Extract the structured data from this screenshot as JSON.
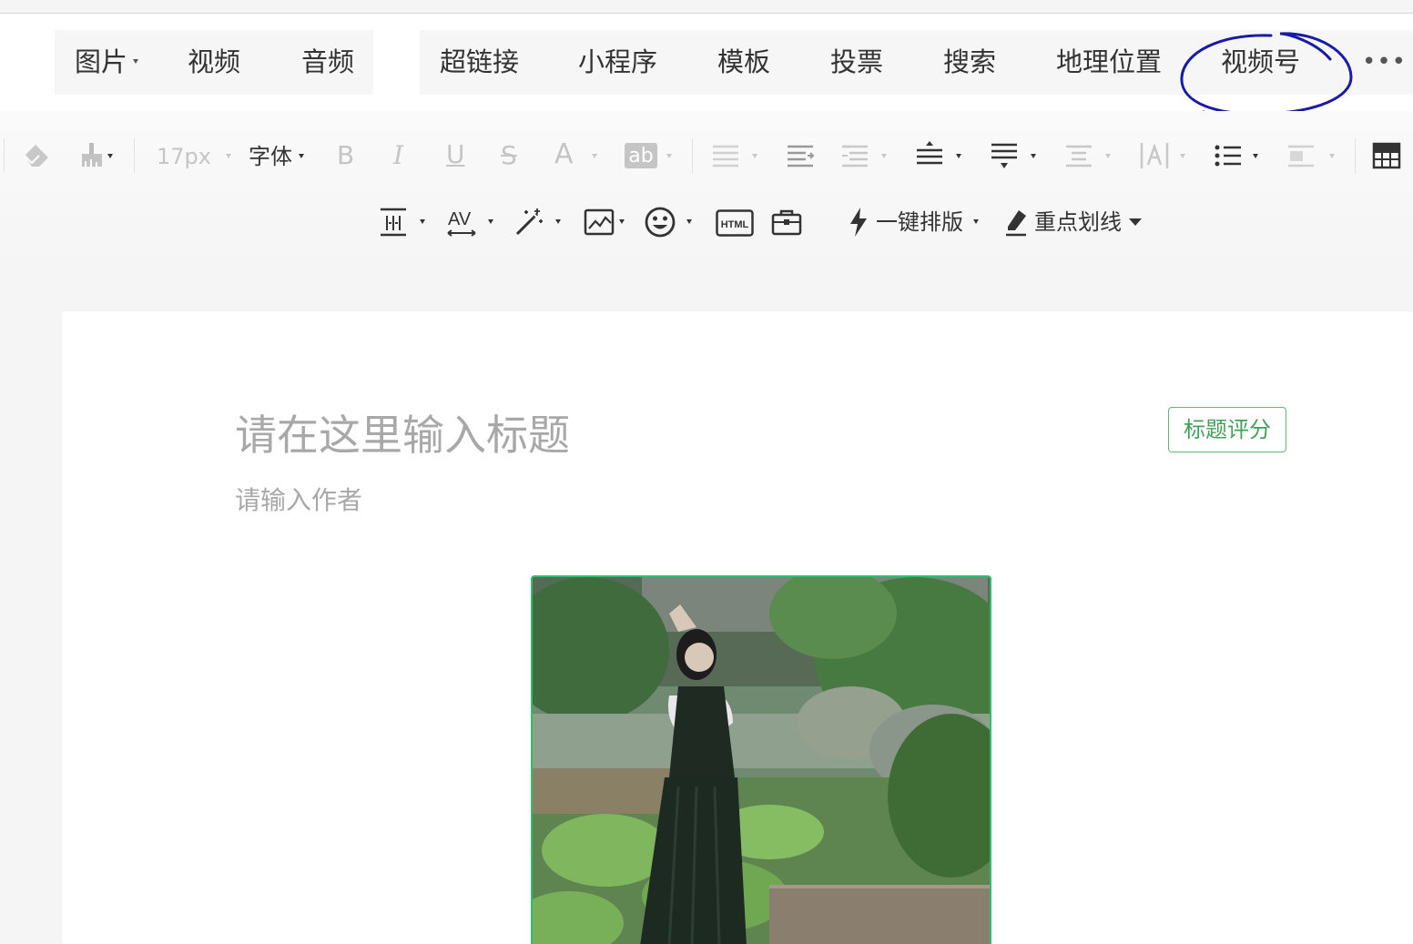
{
  "insert_bar": {
    "media": [
      "图片",
      "视频",
      "音频"
    ],
    "tools": [
      "超链接",
      "小程序",
      "模板",
      "投票",
      "搜索",
      "地理位置",
      "视频号"
    ],
    "more": "•••"
  },
  "format_bar": {
    "font_size": "17px",
    "font_family": "字体",
    "bold": "B",
    "italic": "I",
    "underline": "U",
    "strikethrough": "S",
    "font_color": "A",
    "bg_color": "ab",
    "one_click_layout": "一键排版",
    "highlight_underline": "重点划线",
    "html_label": "HTML"
  },
  "article": {
    "title_placeholder": "请在这里输入标题",
    "author_placeholder": "请输入作者",
    "title_score_button": "标题评分"
  },
  "colors": {
    "accent_green": "#43a05b",
    "annotation_blue": "#1a1aa8"
  },
  "icons": [
    "eraser-icon",
    "format-painter-icon",
    "align-icon",
    "indent-icon",
    "line-height-icon",
    "letter-spacing-icon",
    "magic-wand-icon",
    "image-icon",
    "emoji-icon",
    "html-icon",
    "toolbox-icon",
    "lightning-icon",
    "marker-icon",
    "table-icon"
  ]
}
